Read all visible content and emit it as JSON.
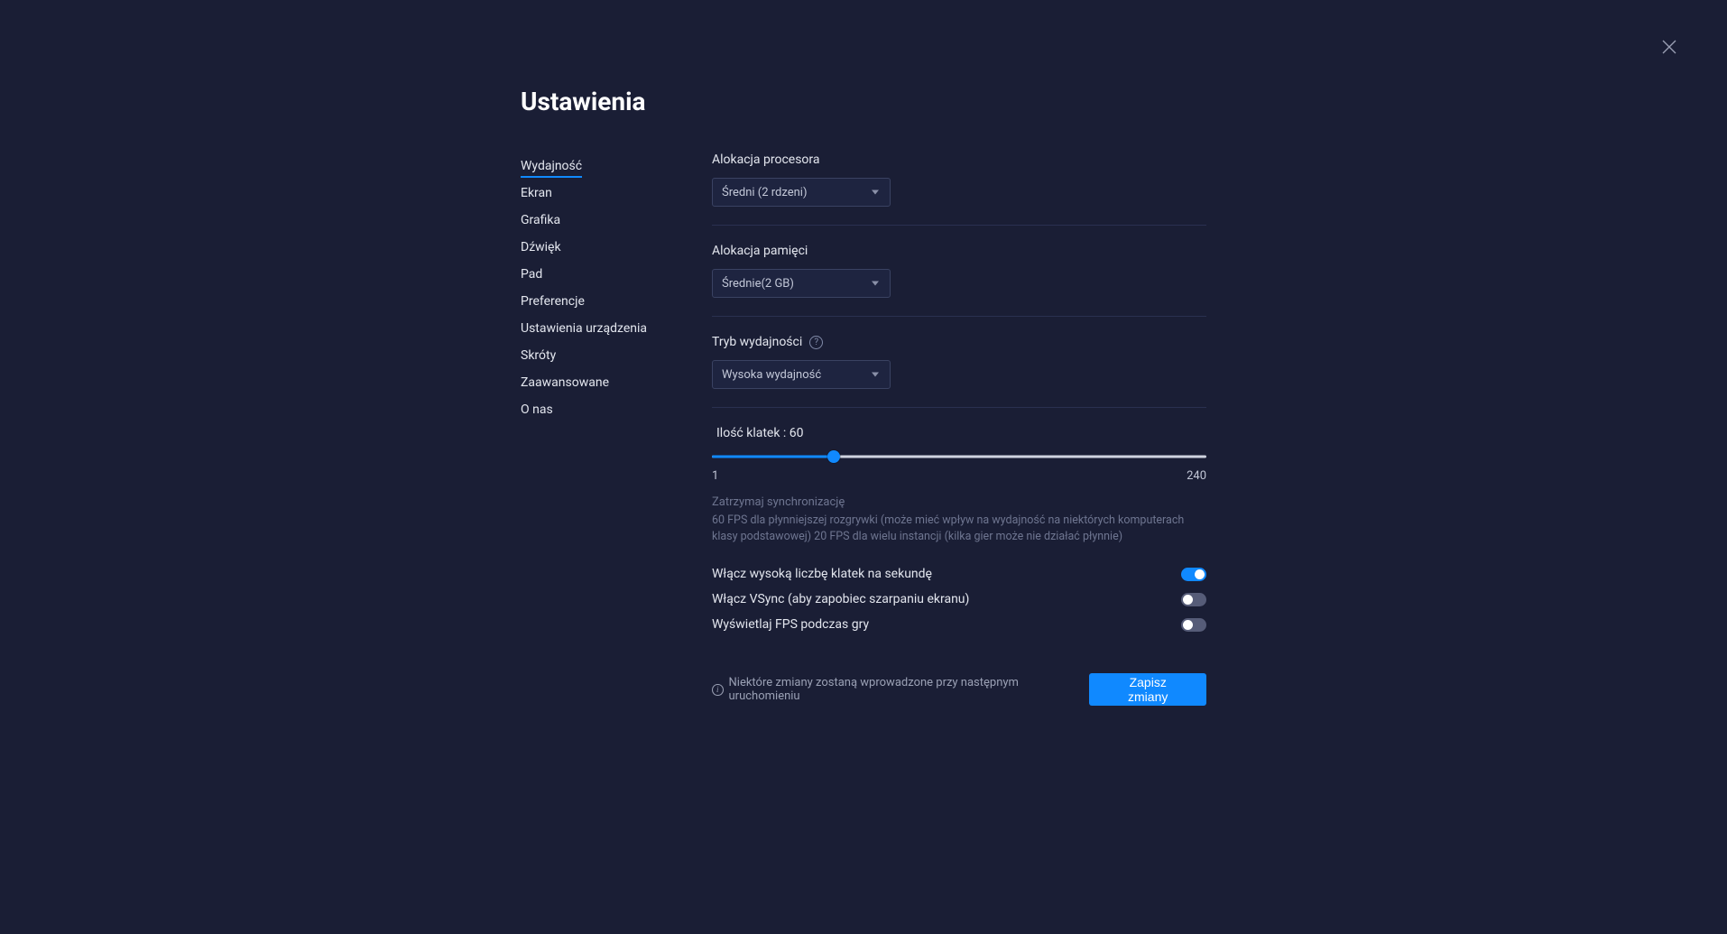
{
  "title": "Ustawienia",
  "sidebar": {
    "items": [
      {
        "label": "Wydajność",
        "active": true
      },
      {
        "label": "Ekran"
      },
      {
        "label": "Grafika"
      },
      {
        "label": "Dźwięk"
      },
      {
        "label": "Pad"
      },
      {
        "label": "Preferencje"
      },
      {
        "label": "Ustawienia urządzenia"
      },
      {
        "label": "Skróty"
      },
      {
        "label": "Zaawansowane"
      },
      {
        "label": "O nas"
      }
    ]
  },
  "cpu": {
    "label": "Alokacja procesora",
    "value": "Średni (2 rdzeni)"
  },
  "memory": {
    "label": "Alokacja pamięci",
    "value": "Średnie(2 GB)"
  },
  "perfmode": {
    "label": "Tryb wydajności",
    "value": "Wysoka wydajność"
  },
  "fps": {
    "label_prefix": "Ilość klatek : ",
    "value": 60,
    "min": 1,
    "max": 240,
    "min_label": "1",
    "max_label": "240"
  },
  "syncnote": {
    "title": "Zatrzymaj synchronizację",
    "desc": "60 FPS dla płynniejszej rozgrywki (może mieć wpływ na wydajność na niektórych komputerach klasy podstawowej) 20 FPS dla wielu instancji (kilka gier może nie działać płynnie)"
  },
  "toggles": {
    "highfps": {
      "label": "Włącz wysoką liczbę klatek na sekundę",
      "on": true
    },
    "vsync": {
      "label": "Włącz VSync (aby zapobiec szarpaniu ekranu)",
      "on": false
    },
    "showfps": {
      "label": "Wyświetlaj FPS podczas gry",
      "on": false
    }
  },
  "footer": {
    "note": "Niektóre zmiany zostaną wprowadzone przy następnym uruchomieniu",
    "save": "Zapisz zmiany"
  }
}
